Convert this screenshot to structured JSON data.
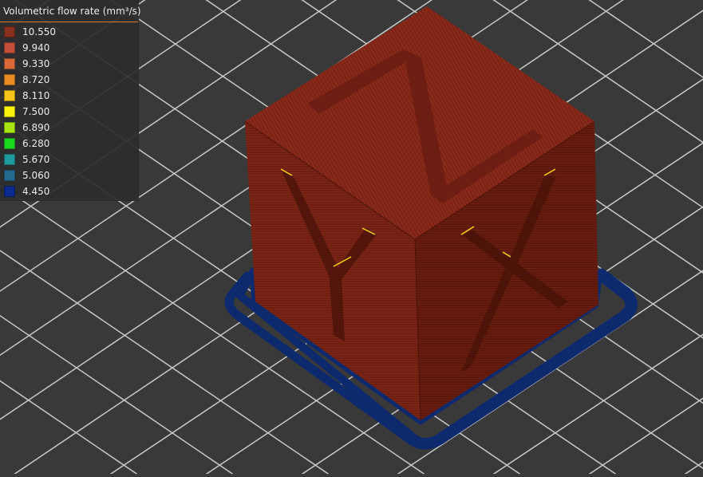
{
  "legend": {
    "title": "Volumetric flow rate (mm³/s)",
    "items": [
      {
        "value": "10.550",
        "color": "#8a2f1d"
      },
      {
        "value": "9.940",
        "color": "#c24e3c"
      },
      {
        "value": "9.330",
        "color": "#d9693a"
      },
      {
        "value": "8.720",
        "color": "#ec8a25"
      },
      {
        "value": "8.110",
        "color": "#f5c21a"
      },
      {
        "value": "7.500",
        "color": "#fbf40d"
      },
      {
        "value": "6.890",
        "color": "#a8e314"
      },
      {
        "value": "6.280",
        "color": "#1bd71f"
      },
      {
        "value": "5.670",
        "color": "#1f9b9b"
      },
      {
        "value": "5.060",
        "color": "#226b8f"
      },
      {
        "value": "4.450",
        "color": "#0c2a8a"
      }
    ]
  },
  "scene": {
    "object": "calibration-cube",
    "background_color": "#393939",
    "grid_color": "#d9d9d9",
    "cube_colors": {
      "top": "#7f2516",
      "left": "#6e1f12",
      "right": "#5d180d"
    },
    "skirt_color": "#0e2a6e"
  }
}
